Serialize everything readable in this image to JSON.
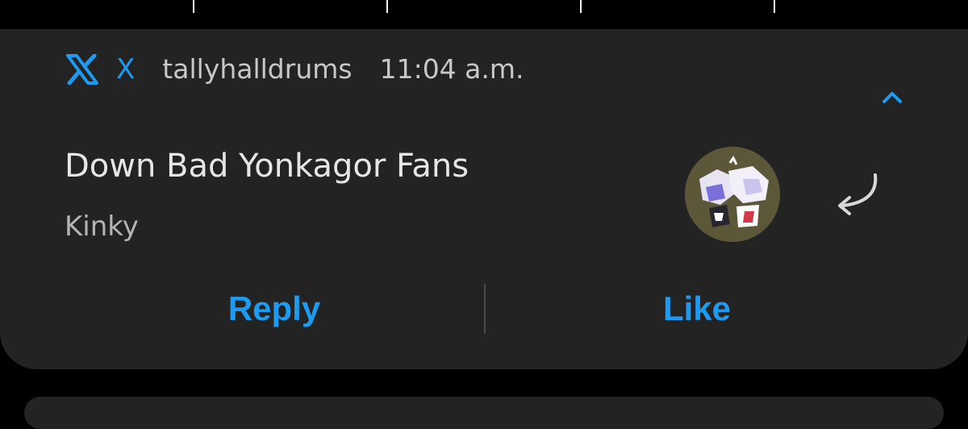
{
  "notification": {
    "app_icon": "x-logo-icon",
    "app_name": "X",
    "account": "tallyhalldrums",
    "time": "11:04 a.m.",
    "title": "Down Bad Yonkagor Fans",
    "body": "Kinky",
    "collapse_icon": "chevron-up-icon",
    "quick_reply_icon": "reply-arrow-icon",
    "actions": {
      "reply_label": "Reply",
      "like_label": "Like"
    }
  },
  "colors": {
    "background": "#000000",
    "card": "#232323",
    "accent": "#1d9bf0",
    "title_text": "#e6e6e6",
    "secondary_text": "#c8c8c8"
  }
}
